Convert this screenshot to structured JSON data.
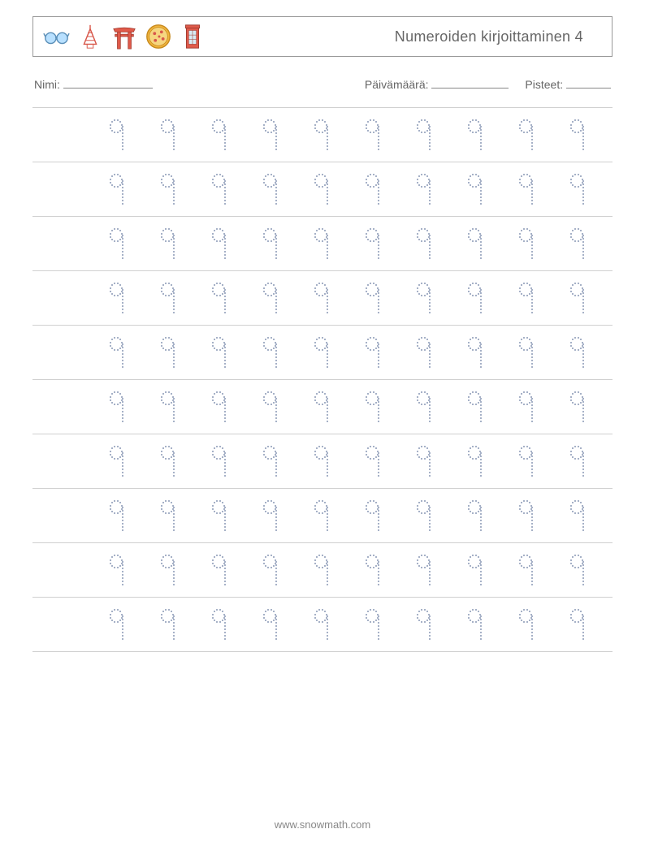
{
  "title": "Numeroiden kirjoittaminen 4",
  "meta": {
    "name_label": "Nimi:",
    "date_label": "Päivämäärä:",
    "score_label": "Pisteet:"
  },
  "icons": [
    "glasses-icon",
    "tower-icon",
    "torii-gate-icon",
    "pizza-icon",
    "phone-booth-icon"
  ],
  "worksheet": {
    "rows": 10,
    "cols": 10,
    "digit": "9"
  },
  "footer": "www.snowmath.com"
}
